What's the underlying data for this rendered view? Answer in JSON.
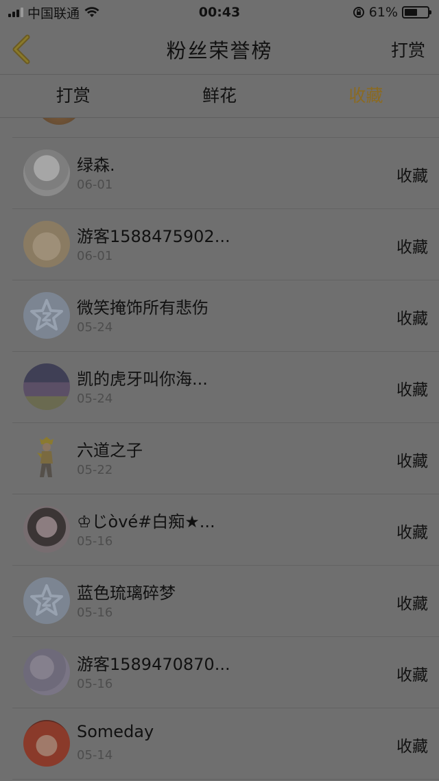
{
  "status_bar": {
    "carrier": "中国联通",
    "time": "00:43",
    "battery_percent": "61%",
    "battery_level": 0.61
  },
  "nav": {
    "title": "粉丝荣誉榜",
    "right_label": "打赏"
  },
  "tabs": [
    {
      "label": "打赏",
      "active": false
    },
    {
      "label": "鲜花",
      "active": false
    },
    {
      "label": "收藏",
      "active": true
    }
  ],
  "colors": {
    "accent": "#8a6a22",
    "overlay_bg": "#6f6f6f"
  },
  "fans": [
    {
      "name": "绿森.",
      "date": "06-01",
      "action": "收藏",
      "avatar": "blonde-girl-avatar"
    },
    {
      "name": "游客1588475902...",
      "date": "06-01",
      "action": "收藏",
      "avatar": "teddy-bear-avatar"
    },
    {
      "name": "微笑掩饰所有悲伤",
      "date": "05-24",
      "action": "收藏",
      "avatar": "default-star-avatar"
    },
    {
      "name": "凯的虎牙叫你海...",
      "date": "05-24",
      "action": "收藏",
      "avatar": "group-photo-avatar"
    },
    {
      "name": "六道之子",
      "date": "05-22",
      "action": "收藏",
      "avatar": "anime-character-avatar"
    },
    {
      "name": "♔じòvé#白痴★...",
      "date": "05-16",
      "action": "收藏",
      "avatar": "girl-photo-avatar"
    },
    {
      "name": "蓝色琉璃碎梦",
      "date": "05-16",
      "action": "收藏",
      "avatar": "default-star-avatar"
    },
    {
      "name": "游客1589470870...",
      "date": "05-16",
      "action": "收藏",
      "avatar": "flowers-avatar"
    },
    {
      "name": "Someday",
      "date": "05-14",
      "action": "收藏",
      "avatar": "red-hair-anime-avatar"
    }
  ]
}
